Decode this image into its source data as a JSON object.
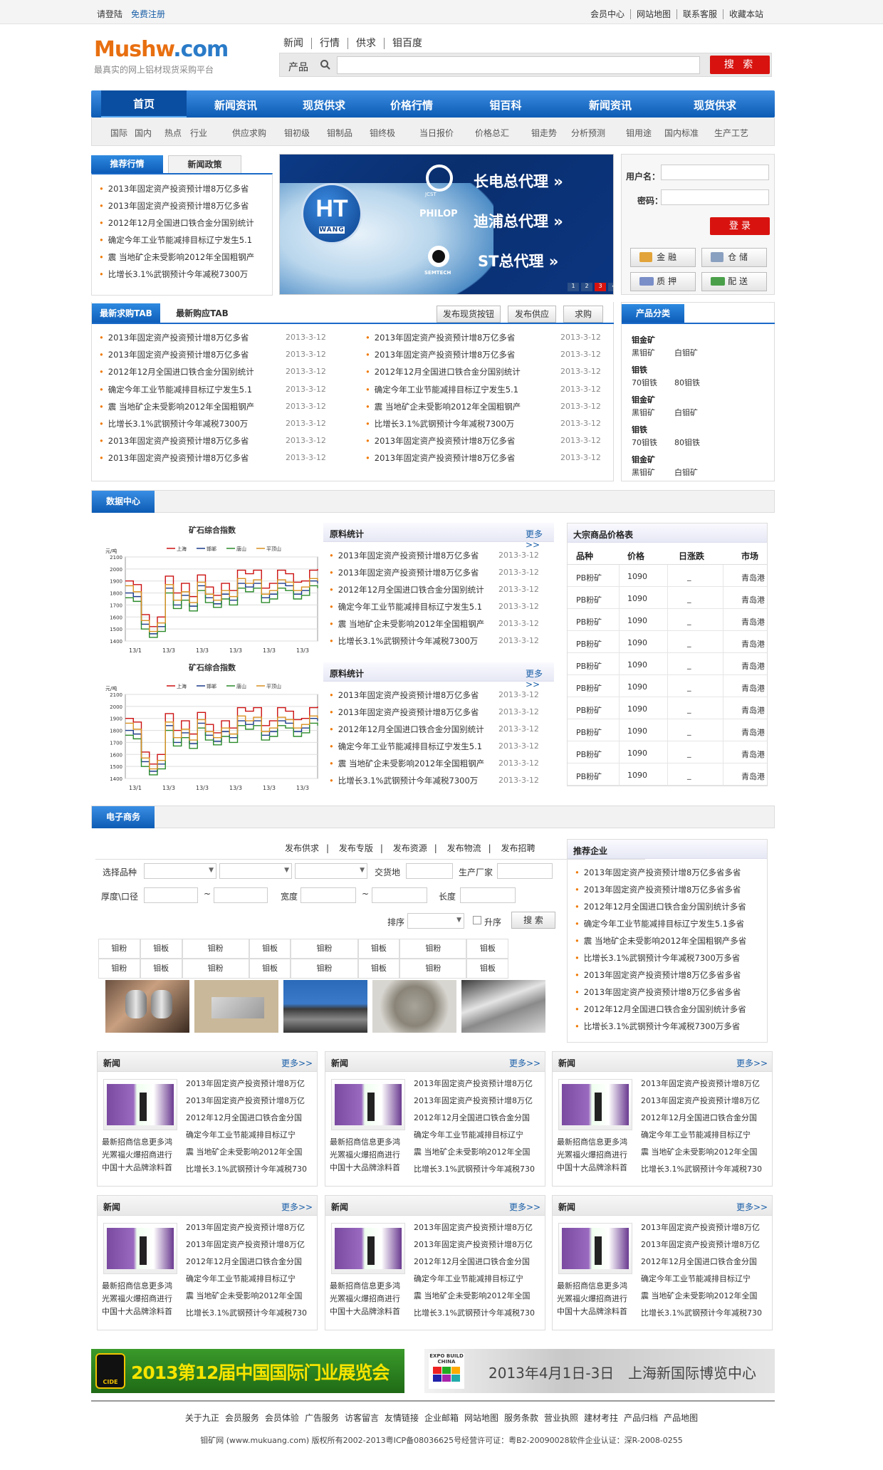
{
  "topbar": {
    "login": "请登陆",
    "register": "免费注册",
    "links": [
      "会员中心",
      "网站地图",
      "联系客服",
      "收藏本站"
    ]
  },
  "logo": {
    "main": "Mushw",
    "dom": ".com",
    "slogan": "最真实的网上铝材现货采购平台"
  },
  "header_nav": [
    "新闻",
    "行情",
    "供求",
    "钼百度"
  ],
  "search": {
    "label": "产品",
    "button": "搜 索"
  },
  "main_nav": [
    "首页",
    "新闻资讯",
    "现货供求",
    "价格行情",
    "钼百科",
    "新闻资讯",
    "现货供求"
  ],
  "sub_nav": [
    "国际",
    "国内",
    "热点",
    "行业",
    "供应求购",
    "钼初级",
    "钼制品",
    "钼终极",
    "当日报价",
    "价格总汇",
    "钼走势",
    "分析预测",
    "钼用途",
    "国内标准",
    "生产工艺"
  ],
  "news_tabs": [
    "推荐行情",
    "新闻政策"
  ],
  "news_list": [
    "2013年固定资产投资预计增8万亿多省",
    "2013年固定资产投资预计增8万亿多省",
    "2012年12月全国进口铁合金分国别统计",
    "确定今年工业节能减排目标辽宁发生5.1",
    "震 当地矿企未受影响2012年全国粗钢产",
    "比增长3.1%武钢预计今年减税7300万"
  ],
  "banner": {
    "logo": "HT",
    "logo_sub": "WANG",
    "l1": "长电总代理",
    "l2": "迪浦总代理",
    "l3": "ST总代理",
    "b1": "JCST",
    "b2": "PHILOP",
    "b3": "SEMTECH",
    "pages": [
      "1",
      "2",
      "3",
      "4"
    ]
  },
  "login": {
    "user_label": "用户名：",
    "pass_label": "密码：",
    "button": "登 录",
    "services": [
      "金 融",
      "仓 储",
      "质 押",
      "配 送"
    ]
  },
  "supply_tabs": [
    "最新求购TAB",
    "最新购应TAB"
  ],
  "supply_buttons": [
    "发布现货按钮",
    "发布供应",
    "求购"
  ],
  "supply_items": [
    "2013年固定资产投资预计增8万亿多省",
    "2013年固定资产投资预计增8万亿多省",
    "2012年12月全国进口铁合金分国别统计",
    "确定今年工业节能减排目标辽宁发生5.1",
    "震 当地矿企未受影响2012年全国粗钢产",
    "比增长3.1%武钢预计今年减税7300万",
    "2013年固定资产投资预计增8万亿多省",
    "2013年固定资产投资预计增8万亿多省"
  ],
  "date": "2013-3-12",
  "category": {
    "title": "产品分类",
    "groups": [
      {
        "h": "钼金矿",
        "a": "黑钼矿",
        "b": "白钼矿"
      },
      {
        "h": "钼铁",
        "a": "70钼铁",
        "b": "80钼铁"
      },
      {
        "h": "钼金矿",
        "a": "黑钼矿",
        "b": "白钼矿"
      },
      {
        "h": "钼铁",
        "a": "70钼铁",
        "b": "80钼铁"
      },
      {
        "h": "钼金矿",
        "a": "黑钼矿",
        "b": "白钼矿"
      }
    ]
  },
  "data_center": {
    "title": "数据中心"
  },
  "chart_data": [
    {
      "type": "line",
      "title": "矿石综合指数",
      "ylabel": "元/吨",
      "ylim": [
        1400,
        2100
      ],
      "yticks": [
        "2100",
        "2000",
        "1900",
        "1800",
        "1700",
        "1600",
        "1500",
        "1400"
      ],
      "categories": [
        "13/1",
        "13/3",
        "13/3",
        "13/3",
        "13/3",
        "13/3"
      ],
      "series": [
        {
          "name": "上海",
          "color": "#cc1010",
          "values": [
            1900,
            1870,
            1620,
            1520,
            1600,
            1940,
            1800,
            1880,
            1770,
            1950,
            1850,
            1780,
            1880,
            1820,
            1990,
            1960,
            1990,
            1840,
            1880,
            1990,
            1960,
            1890,
            1900,
            1990,
            2000
          ]
        },
        {
          "name": "邯郸",
          "color": "#1a3a8a",
          "values": [
            1800,
            1770,
            1540,
            1460,
            1520,
            1840,
            1700,
            1780,
            1690,
            1860,
            1760,
            1710,
            1790,
            1740,
            1880,
            1850,
            1880,
            1760,
            1790,
            1880,
            1860,
            1790,
            1820,
            1900,
            1880
          ]
        },
        {
          "name": "唐山",
          "color": "#2a8a2a",
          "values": [
            1760,
            1730,
            1500,
            1430,
            1480,
            1800,
            1670,
            1740,
            1650,
            1820,
            1720,
            1680,
            1750,
            1700,
            1840,
            1810,
            1840,
            1720,
            1750,
            1840,
            1820,
            1750,
            1780,
            1860,
            1840
          ]
        },
        {
          "name": "平顶山",
          "color": "#d89020",
          "values": [
            1860,
            1810,
            1570,
            1480,
            1550,
            1870,
            1740,
            1810,
            1720,
            1890,
            1790,
            1740,
            1820,
            1770,
            1920,
            1880,
            1910,
            1790,
            1820,
            1910,
            1890,
            1820,
            1850,
            1920,
            1900
          ]
        }
      ]
    },
    {
      "type": "line",
      "title": "矿石综合指数",
      "ylabel": "元/吨",
      "ylim": [
        1400,
        2100
      ],
      "yticks": [
        "2100",
        "2000",
        "1900",
        "1800",
        "1700",
        "1600",
        "1500",
        "1400"
      ],
      "categories": [
        "13/1",
        "13/3",
        "13/3",
        "13/3",
        "13/3",
        "13/3"
      ],
      "series": [
        {
          "name": "上海",
          "color": "#cc1010",
          "values": [
            1900,
            1870,
            1620,
            1520,
            1600,
            1940,
            1800,
            1880,
            1770,
            1950,
            1850,
            1780,
            1880,
            1820,
            1990,
            1960,
            1990,
            1840,
            1880,
            1990,
            1960,
            1890,
            1900,
            1990,
            2000
          ]
        },
        {
          "name": "邯郸",
          "color": "#1a3a8a",
          "values": [
            1800,
            1770,
            1540,
            1460,
            1520,
            1840,
            1700,
            1780,
            1690,
            1860,
            1760,
            1710,
            1790,
            1740,
            1880,
            1850,
            1880,
            1760,
            1790,
            1880,
            1860,
            1790,
            1820,
            1900,
            1880
          ]
        },
        {
          "name": "唐山",
          "color": "#2a8a2a",
          "values": [
            1760,
            1730,
            1500,
            1430,
            1480,
            1800,
            1670,
            1740,
            1650,
            1820,
            1720,
            1680,
            1750,
            1700,
            1840,
            1810,
            1840,
            1720,
            1750,
            1840,
            1820,
            1750,
            1780,
            1860,
            1840
          ]
        },
        {
          "name": "平顶山",
          "color": "#d89020",
          "values": [
            1860,
            1810,
            1570,
            1480,
            1550,
            1870,
            1740,
            1810,
            1720,
            1890,
            1790,
            1740,
            1820,
            1770,
            1920,
            1880,
            1910,
            1790,
            1820,
            1910,
            1890,
            1820,
            1850,
            1920,
            1900
          ]
        }
      ]
    }
  ],
  "raw_stats": {
    "title": "原料统计",
    "more": "更多>>"
  },
  "price_table": {
    "title": "大宗商品价格表",
    "headers": [
      "品种",
      "价格",
      "日涨跌",
      "市场"
    ],
    "row": [
      "PB粉矿",
      "1090",
      "_",
      "青岛港"
    ]
  },
  "ecommerce": {
    "title": "电子商务",
    "links": [
      "发布供求",
      "发布专版",
      "发布资源",
      "发布物流",
      "发布招聘"
    ],
    "labels": {
      "variety": "选择品种",
      "delivery": "交货地",
      "maker": "生产厂家",
      "thick": "厚度\\口径",
      "tilde": "~",
      "width": "宽度",
      "length": "长度",
      "sort": "排序",
      "asc": "升序",
      "search": "搜 索"
    },
    "grid": [
      "钼粉",
      "钼板",
      "钼粉",
      "钼板",
      "钼粉",
      "钼板",
      "钼粉",
      "钼板"
    ]
  },
  "recommend": {
    "title": "推荐企业",
    "items": [
      "2013年固定资产投资预计增8万亿多省多省",
      "2013年固定资产投资预计增8万亿多省多省",
      "2012年12月全国进口铁合金分国别统计多省",
      "确定今年工业节能减排目标辽宁发生5.1多省",
      "震 当地矿企未受影响2012年全国粗钢产多省",
      "比增长3.1%武钢预计今年减税7300万多省",
      "2013年固定资产投资预计增8万亿多省多省",
      "2013年固定资产投资预计增8万亿多省多省",
      "2012年12月全国进口铁合金分国别统计多省",
      "比增长3.1%武钢预计今年减税7300万多省"
    ]
  },
  "news_boxes": {
    "title": "新闻",
    "more": "更多>>",
    "caption": [
      "最新招商信息更多鸿",
      "光罴福火爆招商进行",
      "中国十大品牌涂料首"
    ],
    "items": [
      "2013年固定资产投资预计增8万亿",
      "2013年固定资产投资预计增8万亿",
      "2012年12月全国进口铁合金分国",
      "确定今年工业节能减排目标辽宁",
      "震 当地矿企未受影响2012年全国",
      "比增长3.1%武钢预计今年减税730"
    ]
  },
  "ads": {
    "left_logo": "CIDE",
    "left_text": "2013第12届中国国际门业展览会",
    "right_logo_top": "EXPO BUILD",
    "right_logo_bot": "CHINA",
    "right_date": "2013年4月1日-3日",
    "right_place": "上海新国际博览中心"
  },
  "footer": {
    "links": [
      "关于九正",
      "会员服务",
      "会员体验",
      "广告服务",
      "访客留言",
      "友情链接",
      "企业邮箱",
      "网站地图",
      "服务条款",
      "营业执照",
      "建材考拄",
      "产品归档",
      "产品地图"
    ],
    "copyright": "钼矿网 (www.mukuang.com) 版权所有2002-2013粤ICP备08036625号经营许可证：粤B2-20090028软件企业认证：深R-2008-0255"
  }
}
